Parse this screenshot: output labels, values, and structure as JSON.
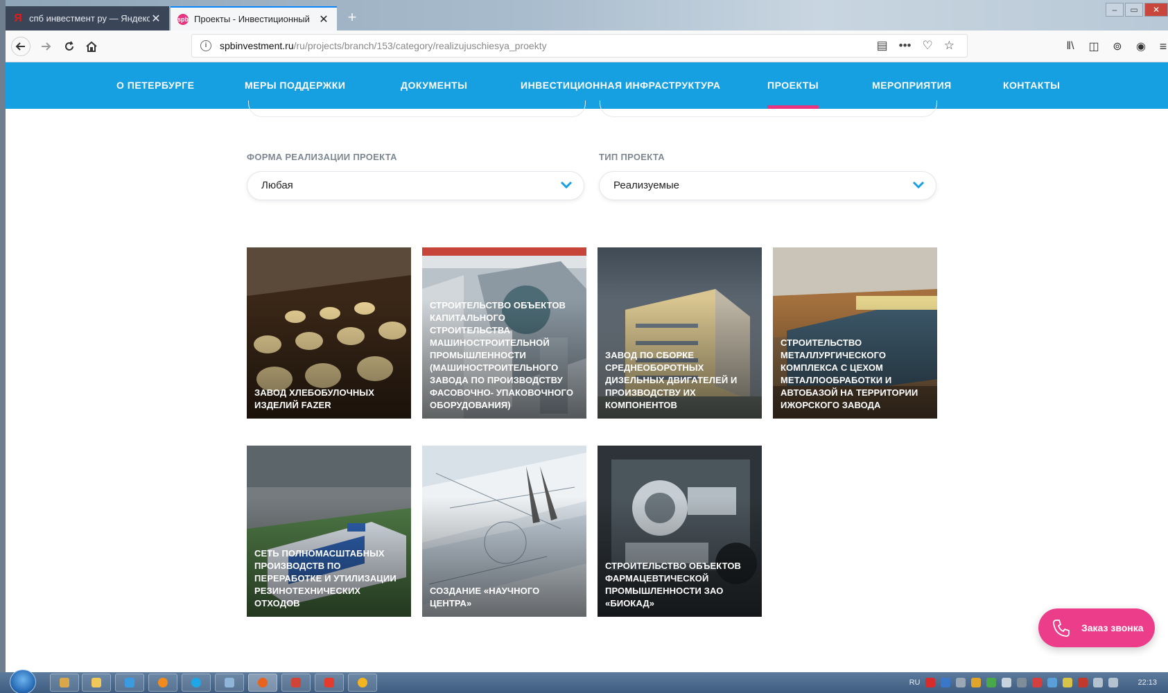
{
  "browser": {
    "tabs": [
      {
        "title": "спб инвестмент ру — Яндекс",
        "active": false
      },
      {
        "title": "Проекты - Инвестиционный",
        "active": true
      }
    ],
    "url_host": "spbinvestment.ru",
    "url_path": "/ru/projects/branch/153/category/realizujuschiesya_proekty"
  },
  "menu": [
    {
      "label": "О ПЕТЕРБУРГЕ",
      "active": false
    },
    {
      "label": "МЕРЫ ПОДДЕРЖКИ",
      "active": false
    },
    {
      "label": "ДОКУМЕНТЫ",
      "active": false
    },
    {
      "label": "ИНВЕСТИЦИОННАЯ ИНФРАСТРУКТУРА",
      "active": false
    },
    {
      "label": "ПРОЕКТЫ",
      "active": true
    },
    {
      "label": "МЕРОПРИЯТИЯ",
      "active": false
    },
    {
      "label": "КОНТАКТЫ",
      "active": false
    }
  ],
  "filters": {
    "form": {
      "label": "ФОРМА РЕАЛИЗАЦИИ ПРОЕКТА",
      "value": "Любая"
    },
    "type": {
      "label": "ТИП ПРОЕКТА",
      "value": "Реализуемые"
    }
  },
  "projects": [
    {
      "title": "ЗАВОД ХЛЕБОБУЛОЧНЫХ ИЗДЕЛИЙ FAZER"
    },
    {
      "title": "СТРОИТЕЛЬСТВО ОБЪЕКТОВ КАПИТАЛЬНОГО СТРОИТЕЛЬСТВА МАШИНОСТРОИТЕЛЬНОЙ ПРОМЫШЛЕННОСТИ (МАШИНОСТРОИТЕЛЬНОГО ЗАВОДА ПО ПРОИЗВОДСТВУ ФАСОВОЧНО- УПАКОВОЧНОГО ОБОРУДОВАНИЯ)"
    },
    {
      "title": "ЗАВОД ПО СБОРКЕ СРЕДНЕОБОРОТНЫХ ДИЗЕЛЬНЫХ ДВИГАТЕЛЕЙ И ПРОИЗВОДСТВУ ИХ КОМПОНЕНТОВ"
    },
    {
      "title": "СТРОИТЕЛЬСТВО МЕТАЛЛУРГИЧЕСКОГО КОМПЛЕКСА С ЦЕХОМ МЕТАЛЛООБРАБОТКИ И АВТОБАЗОЙ НА ТЕРРИТОРИИ ИЖОРСКОГО ЗАВОДА"
    },
    {
      "title": "СЕТЬ ПОЛНОМАСШТАБНЫХ ПРОИЗВОДСТВ ПО ПЕРЕРАБОТКЕ И УТИЛИЗАЦИИ РЕЗИНОТЕХНИЧЕСКИХ ОТХОДОВ"
    },
    {
      "title": "СОЗДАНИЕ «НАУЧНОГО ЦЕНТРА»"
    },
    {
      "title": "СТРОИТЕЛЬСТВО ОБЪЕКТОВ ФАРМАЦЕВТИЧЕСКОЙ ПРОМЫШЛЕННОСТИ ЗАО «БИОКАД»"
    }
  ],
  "callback": {
    "label": "Заказ звонка"
  },
  "taskbar": {
    "lang": "RU",
    "time": "22:13"
  },
  "colors": {
    "brand_blue": "#16a0e2",
    "accent_pink": "#e8337e",
    "callback_pink": "#ec3d8a"
  }
}
